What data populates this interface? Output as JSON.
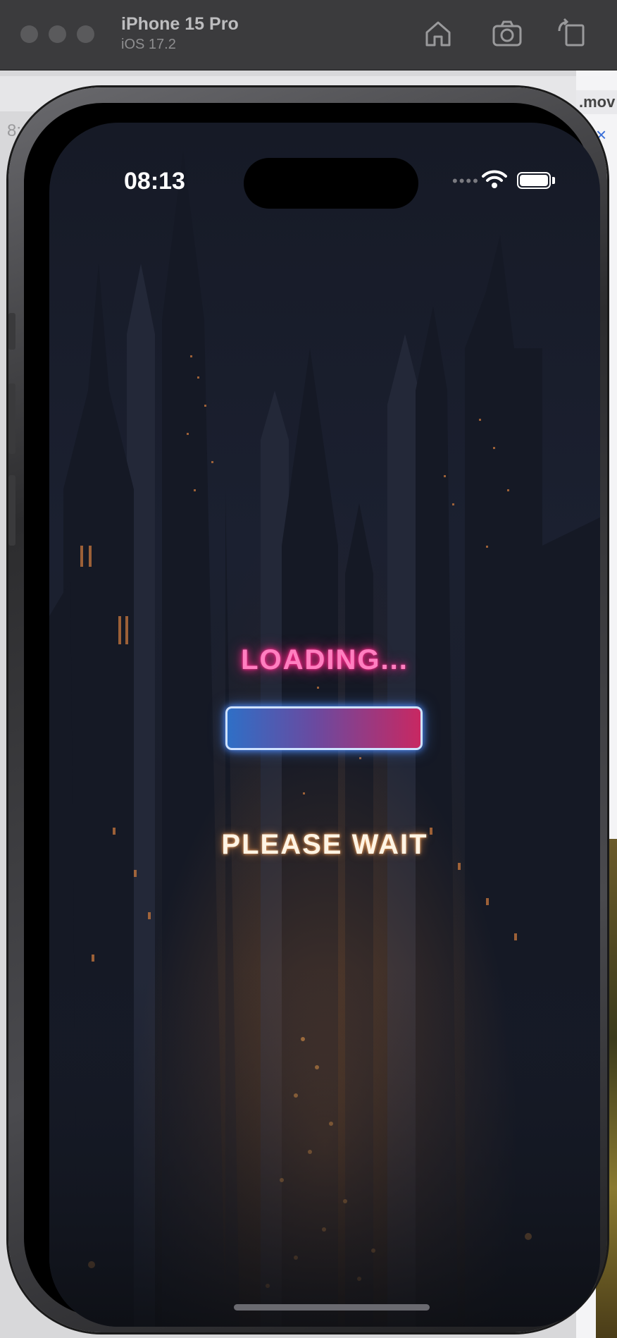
{
  "simulator": {
    "device_name": "iPhone 15 Pro",
    "os_version": "iOS 17.2",
    "toolbar": {
      "home_icon": "home-icon",
      "screenshot_icon": "camera-icon",
      "rotate_icon": "rotate-icon"
    }
  },
  "background": {
    "right_tab_text": ".mov",
    "right_close": "×",
    "left_clip_text": "8:"
  },
  "status_bar": {
    "time": "08:13"
  },
  "app": {
    "loading_text": "LOADING...",
    "progress": 1.0,
    "wait_text": "PLEASE WAIT",
    "colors": {
      "loading_glow": "#ff2a8f",
      "progress_start": "#2f6fc6",
      "progress_end": "#c82862",
      "progress_border": "#cfe2ff",
      "wait_glow": "#ffae66"
    }
  }
}
